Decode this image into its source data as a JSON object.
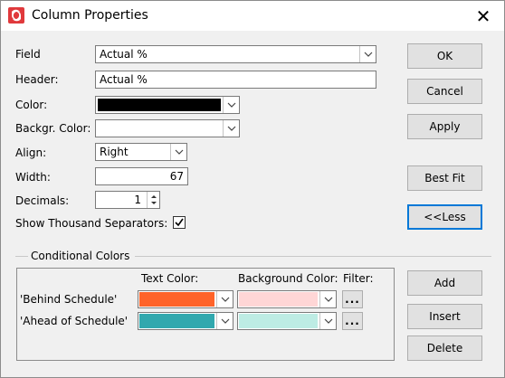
{
  "window": {
    "title": "Column Properties",
    "close_glyph": "✕"
  },
  "fields": {
    "field_label": "Field",
    "field_value": "Actual %",
    "header_label": "Header:",
    "header_value": "Actual %",
    "color_label": "Color:",
    "color_value": "#000000",
    "backgr_label": "Backgr. Color:",
    "backgr_value": "#ffffff",
    "align_label": "Align:",
    "align_value": "Right",
    "width_label": "Width:",
    "width_value": "67",
    "decimals_label": "Decimals:",
    "decimals_value": "1",
    "thousand_label": "Show Thousand Separators:",
    "thousand_checked": true
  },
  "buttons": {
    "ok": "OK",
    "cancel": "Cancel",
    "apply": "Apply",
    "best_fit": "Best Fit",
    "less": "<<Less",
    "add": "Add",
    "insert": "Insert",
    "delete": "Delete"
  },
  "conditional": {
    "group_title": "Conditional Colors",
    "col_text_color": "Text Color:",
    "col_background_color": "Background Color:",
    "col_filter": "Filter:",
    "filter_button": "...",
    "rows": [
      {
        "name": "'Behind Schedule'",
        "text_color": "#ff6329",
        "background_color": "#ffd6d6"
      },
      {
        "name": "'Ahead of Schedule'",
        "text_color": "#31a8ae",
        "background_color": "#bdece4"
      }
    ]
  }
}
